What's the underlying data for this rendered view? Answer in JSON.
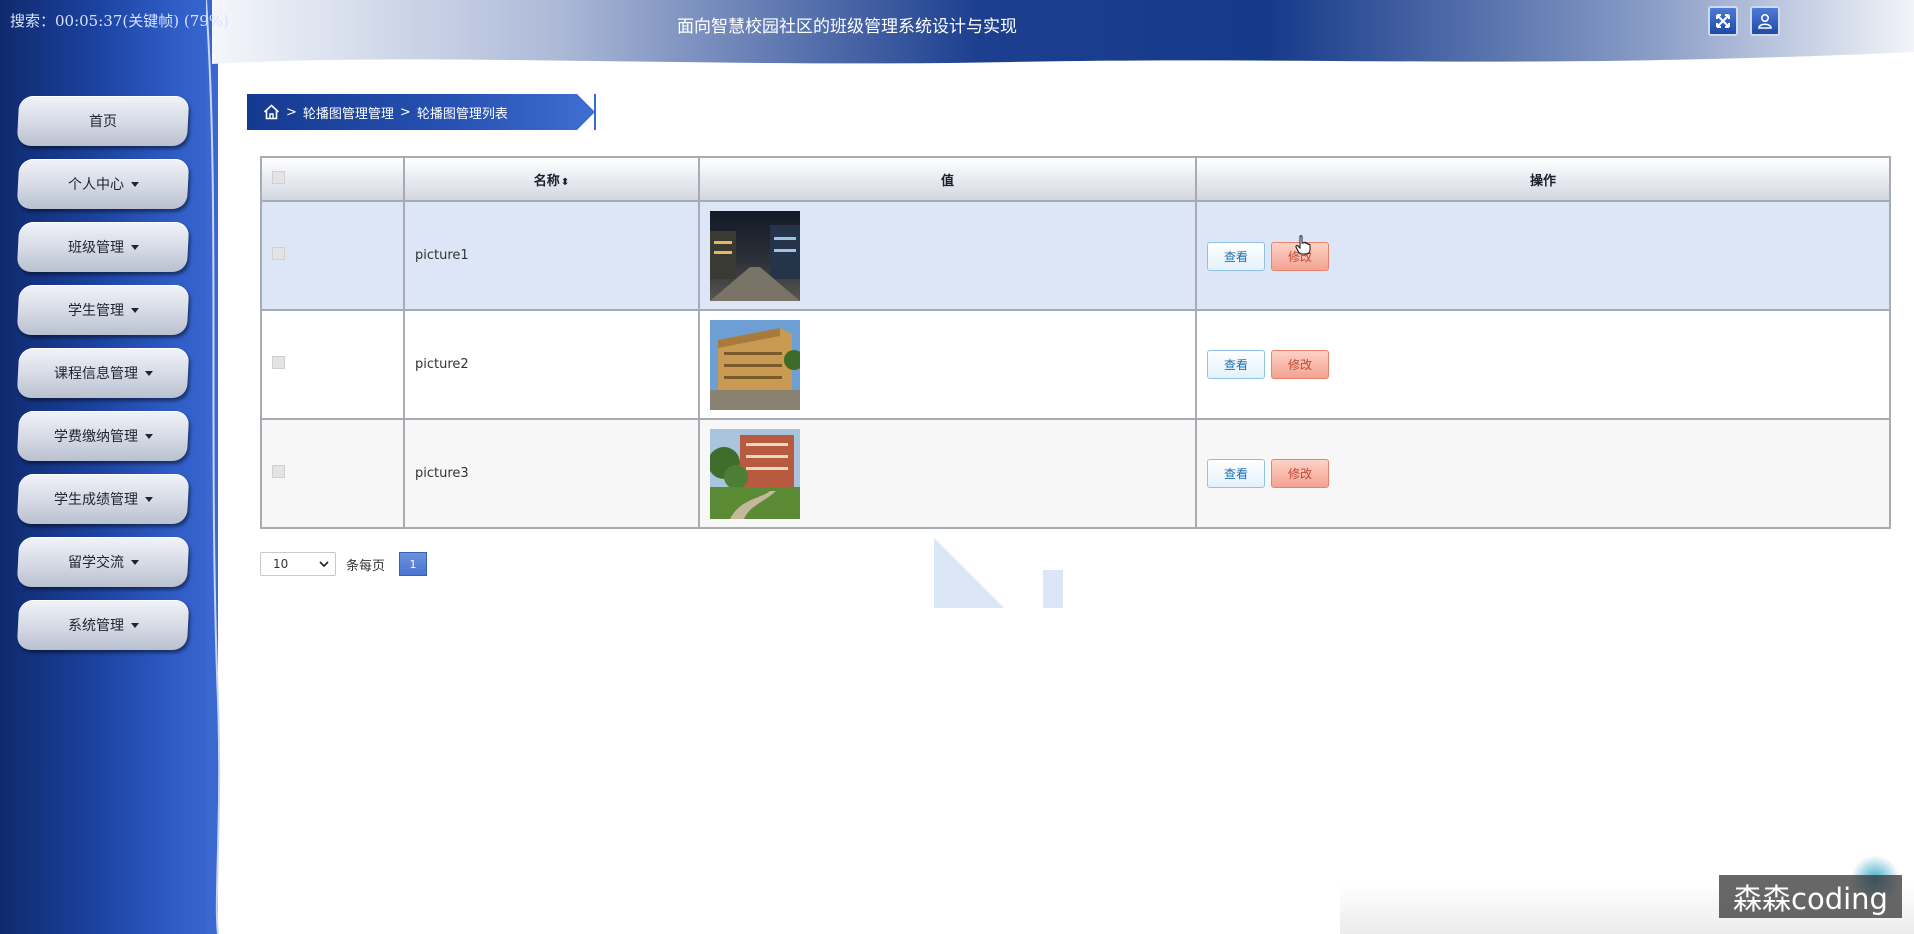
{
  "status_overlay": "搜索：00:05:37(关键帧) (79%)",
  "header": {
    "title": "面向智慧校园社区的班级管理系统设计与实现"
  },
  "sidebar": {
    "items": [
      {
        "label": "首页",
        "dropdown": false
      },
      {
        "label": "个人中心",
        "dropdown": true
      },
      {
        "label": "班级管理",
        "dropdown": true
      },
      {
        "label": "学生管理",
        "dropdown": true
      },
      {
        "label": "课程信息管理",
        "dropdown": true
      },
      {
        "label": "学费缴纳管理",
        "dropdown": true
      },
      {
        "label": "学生成绩管理",
        "dropdown": true
      },
      {
        "label": "留学交流",
        "dropdown": true
      },
      {
        "label": "系统管理",
        "dropdown": true
      }
    ]
  },
  "breadcrumb": {
    "sep": ">",
    "level1": "轮播图管理管理",
    "level2": "轮播图管理列表"
  },
  "table": {
    "headers": {
      "name": "名称",
      "value": "值",
      "actions": "操作"
    },
    "sort_icon": "⬍",
    "rows": [
      {
        "name": "picture1",
        "view_label": "查看",
        "edit_label": "修改"
      },
      {
        "name": "picture2",
        "view_label": "查看",
        "edit_label": "修改"
      },
      {
        "name": "picture3",
        "view_label": "查看",
        "edit_label": "修改"
      }
    ]
  },
  "pagination": {
    "page_size": "10",
    "per_page_label": "条每页",
    "current_page": "1"
  },
  "watermark": "森森coding",
  "colors": {
    "sidebar_dark": "#0f2a6e",
    "sidebar_light": "#3a68d0",
    "accent_blue": "#2752b3",
    "view_btn_text": "#1e6fb0",
    "edit_btn_bg": "#f3a391",
    "active_row": "#dce6f6"
  }
}
